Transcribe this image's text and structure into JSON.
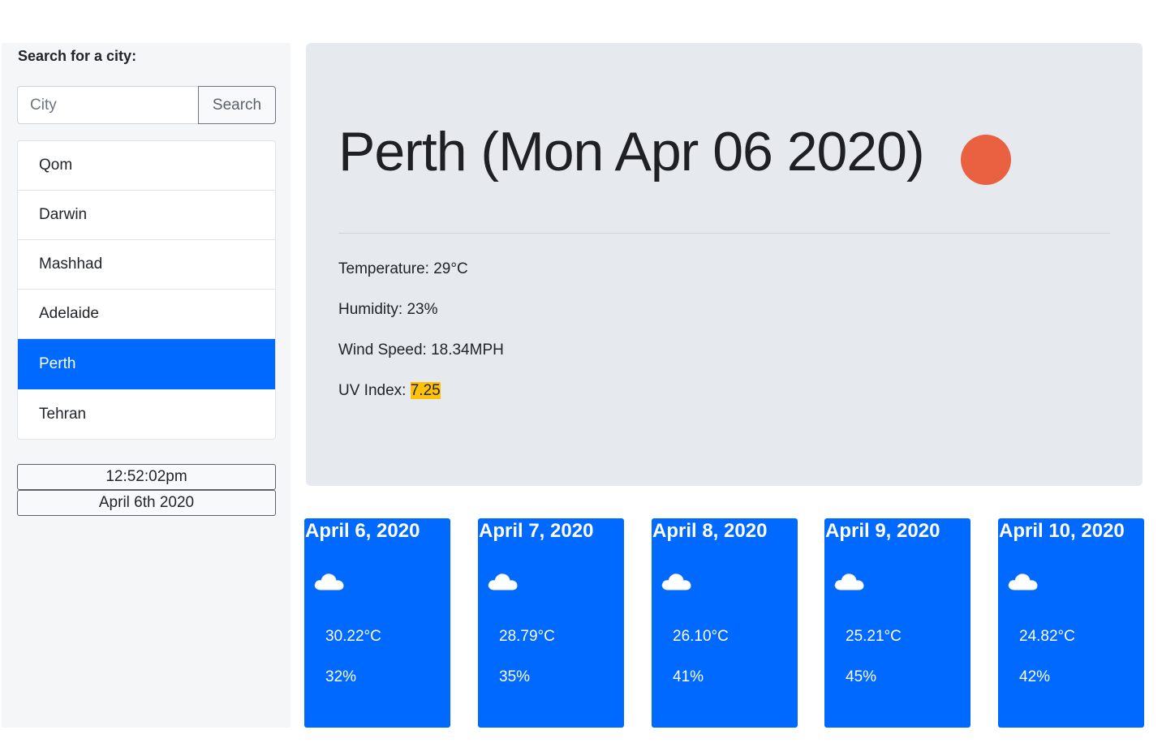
{
  "sidebar": {
    "search_label": "Search for a city:",
    "search_placeholder": "City",
    "search_button": "Search",
    "cities": [
      "Qom",
      "Darwin",
      "Mashhad",
      "Adelaide",
      "Perth",
      "Tehran"
    ],
    "active_city": "Perth",
    "time": "12:52:02pm",
    "date": "April 6th 2020"
  },
  "current": {
    "title": "Perth (Mon Apr 06 2020)",
    "icon": "weather-sun-icon",
    "icon_color": "#e96141",
    "temperature": "Temperature: 29°C",
    "humidity": "Humidity: 23%",
    "wind": "Wind Speed: 18.34MPH",
    "uv_label": "UV Index: ",
    "uv_value": "7.25",
    "uv_color": "#ffc107"
  },
  "forecast": [
    {
      "date": "April 6, 2020",
      "icon": "cloud-icon",
      "temp": "30.22°C",
      "humidity": "32%"
    },
    {
      "date": "April 7, 2020",
      "icon": "cloud-icon",
      "temp": "28.79°C",
      "humidity": "35%"
    },
    {
      "date": "April 8, 2020",
      "icon": "cloud-icon",
      "temp": "26.10°C",
      "humidity": "41%"
    },
    {
      "date": "April 9, 2020",
      "icon": "cloud-icon",
      "temp": "25.21°C",
      "humidity": "45%"
    },
    {
      "date": "April 10, 2020",
      "icon": "cloud-icon",
      "temp": "24.82°C",
      "humidity": "42%"
    }
  ],
  "colors": {
    "accent": "#0069ff",
    "panel": "#e6e9ee"
  }
}
